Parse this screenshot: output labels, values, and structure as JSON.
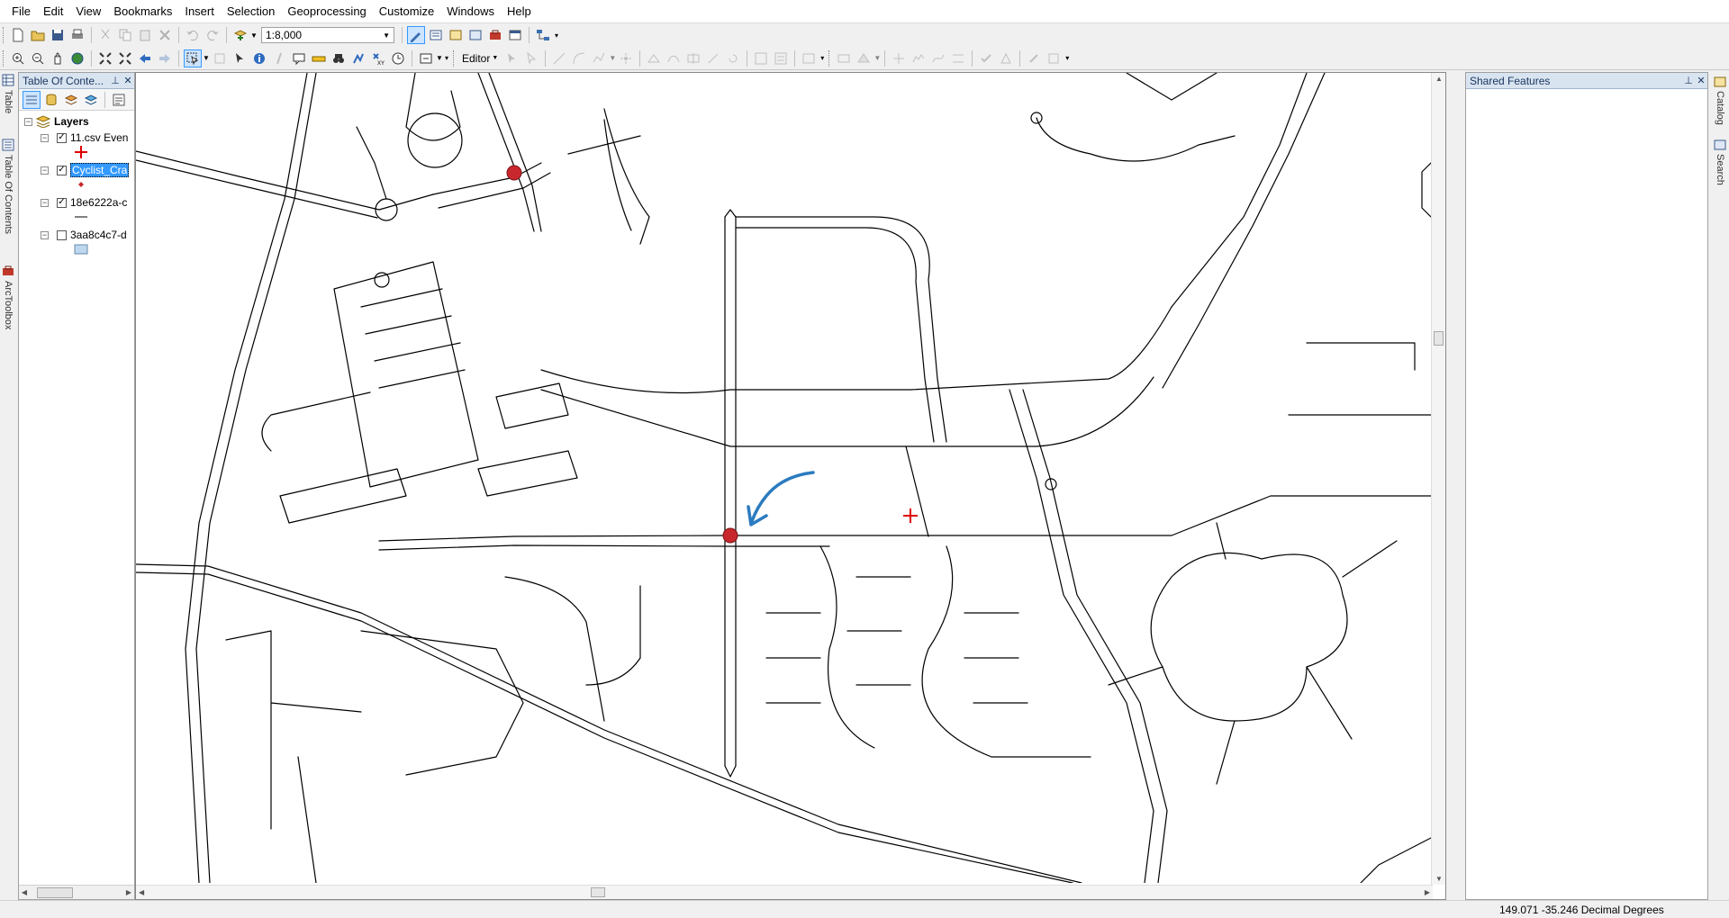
{
  "menus": [
    "File",
    "Edit",
    "View",
    "Bookmarks",
    "Insert",
    "Selection",
    "Geoprocessing",
    "Customize",
    "Windows",
    "Help"
  ],
  "toolbar": {
    "scale": "1:8,000",
    "editor_label": "Editor"
  },
  "left_tabs": [
    "Table",
    "Table Of Contents",
    "ArcToolbox"
  ],
  "right_tabs": [
    "Catalog",
    "Search"
  ],
  "toc": {
    "title": "Table Of Conte...",
    "root_label": "Layers",
    "layers": [
      {
        "label": "11.csv Even",
        "checked": true,
        "selected": false,
        "symbol": "red-cross"
      },
      {
        "label": "Cyclist_Cra",
        "checked": true,
        "selected": true,
        "symbol": "red-diamond"
      },
      {
        "label": "18e6222a-c",
        "checked": true,
        "selected": false,
        "symbol": "black-line"
      },
      {
        "label": "3aa8c4c7-d",
        "checked": false,
        "selected": false,
        "symbol": "blue-polygon"
      }
    ]
  },
  "shared_features": {
    "title": "Shared Features"
  },
  "status": {
    "coordinates": "149.071  -35.246 Decimal Degrees"
  },
  "map": {
    "crash_point_color": "#c8282d",
    "event_cross_color": "#e00000",
    "annotation_arrow_color": "#2b7bbf"
  }
}
